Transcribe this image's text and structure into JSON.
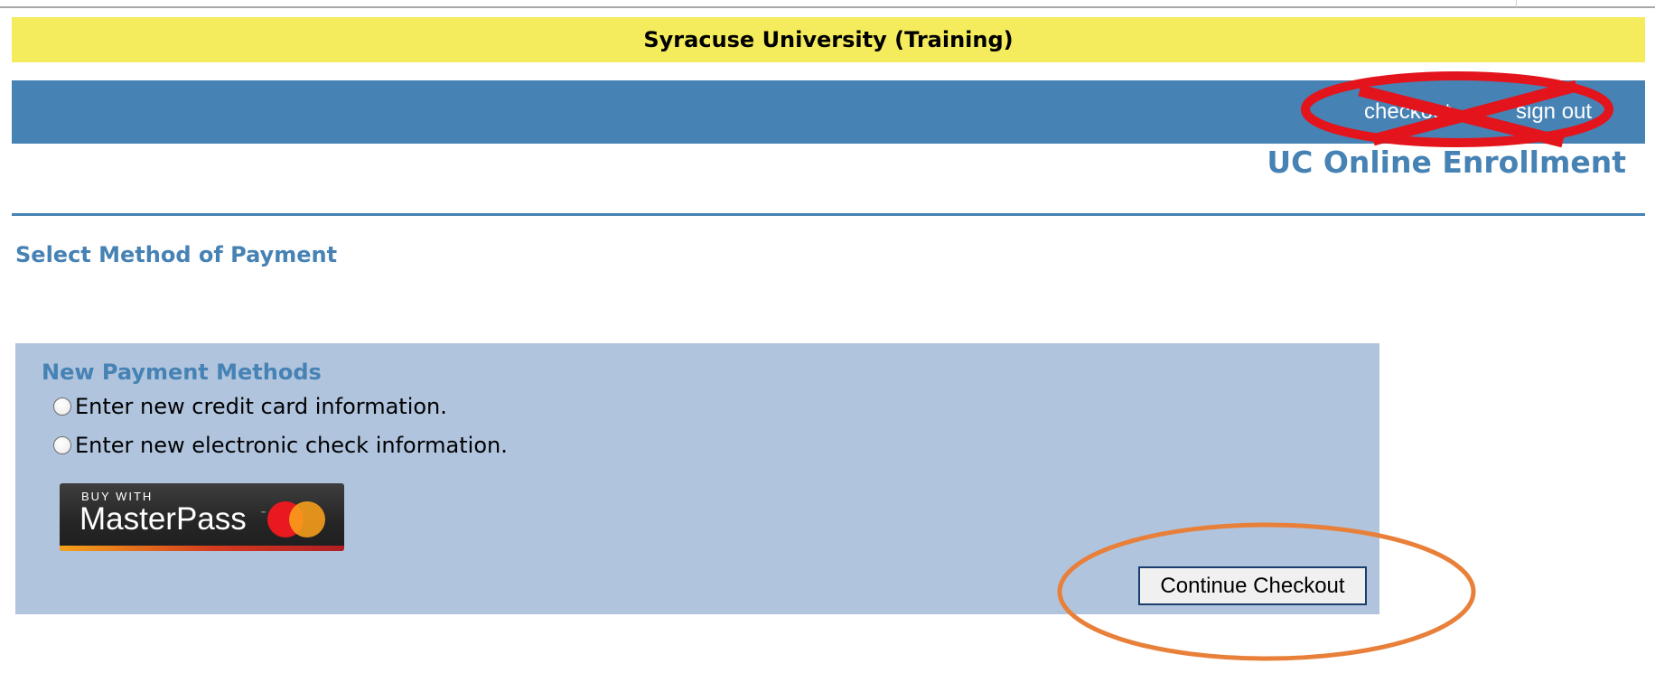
{
  "banner": {
    "institution": "Syracuse University (Training)"
  },
  "nav": {
    "links": [
      "checkout",
      "sign out"
    ]
  },
  "app": {
    "title": "UC Online Enrollment"
  },
  "page": {
    "title": "Select Method of Payment"
  },
  "payment": {
    "section_title": "New Payment Methods",
    "options": [
      {
        "label": "Enter new credit card information.",
        "selected": false
      },
      {
        "label": "Enter new electronic check information.",
        "selected": false
      }
    ],
    "masterpass": {
      "prefix": "BUY WITH",
      "brand": "MasterPass",
      "tm": "™"
    },
    "continue_label": "Continue Checkout"
  },
  "colors": {
    "banner_bg": "#f4ec5c",
    "nav_bg": "#4682b4",
    "accent_text": "#4682b4",
    "panel_bg": "#b0c4de",
    "annotation_red": "#e3141c",
    "annotation_orange": "#e8803a"
  }
}
